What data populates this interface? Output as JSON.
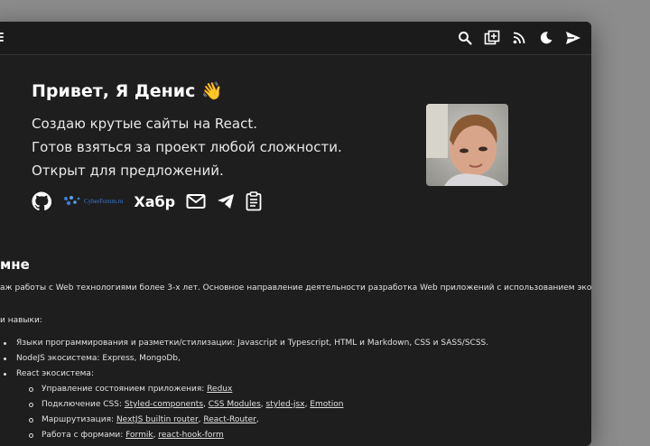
{
  "header": {
    "icons": [
      "menu-icon",
      "search-icon",
      "add-post-icon",
      "rss-icon",
      "theme-moon-icon",
      "send-icon"
    ]
  },
  "hero": {
    "greeting": "Привет, Я Денис 👋",
    "lines": [
      "Создаю крутые сайты на React.",
      "Готов взяться за проект любой сложности.",
      "Открыт для предложений."
    ],
    "social": {
      "github": "github-icon",
      "cyberforum": "CyberForum.ru",
      "habr": "Хабр",
      "email": "mail-icon",
      "telegram": "telegram-icon",
      "resume": "clipboard-icon"
    },
    "avatar": "avatar"
  },
  "about": {
    "title": "мне",
    "text": "аж работы с Web технологиями более 3-х лет. Основное направление деятельности разработка Web приложений с использованием экосистемы",
    "skills_label": "и навыки:",
    "skills": [
      "Языки программирования и разметки/стилизации: Javascript и Typescript, HTML и Markdown, CSS и SASS/SCSS.",
      "NodeJS экосистема: Express, MongoDb,",
      "React экосистема:"
    ],
    "react_items": {
      "state_prefix": "Управление состоянием приложения: ",
      "state_links": [
        "Redux"
      ],
      "css_prefix": "Подключение CSS: ",
      "css_links": [
        "Styled-components",
        "CSS Modules",
        "styled-jsx",
        "Emotion"
      ],
      "routing_prefix": "Маршрутизация: ",
      "routing_links": [
        "NextJS builtin router",
        "React-Router"
      ],
      "forms_prefix": "Работа с формами: ",
      "forms_links": [
        "Formik",
        "react-hook-form"
      ]
    }
  },
  "colors": {
    "background": "#8c8c8c",
    "window": "#1e1e1e",
    "text": "#e8e8e8",
    "accent": "#ffffff"
  }
}
